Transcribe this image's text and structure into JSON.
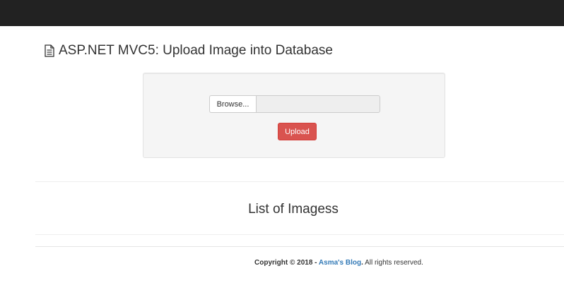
{
  "header": {
    "title": "ASP.NET MVC5: Upload Image into Database",
    "title_icon": "file-text-icon"
  },
  "upload_form": {
    "browse_label": "Browse...",
    "file_name_value": "",
    "upload_label": "Upload",
    "upload_color": "#d9534f"
  },
  "images_section": {
    "heading": "List of Imagess"
  },
  "footer": {
    "copyright_prefix": "Copyright © 2018 - ",
    "blog_link": "Asma's Blog",
    "period": ".",
    "rights": " All rights reserved.",
    "link_color": "#337ab7"
  },
  "colors": {
    "navbar": "#222222",
    "well_background": "#f5f5f5"
  }
}
